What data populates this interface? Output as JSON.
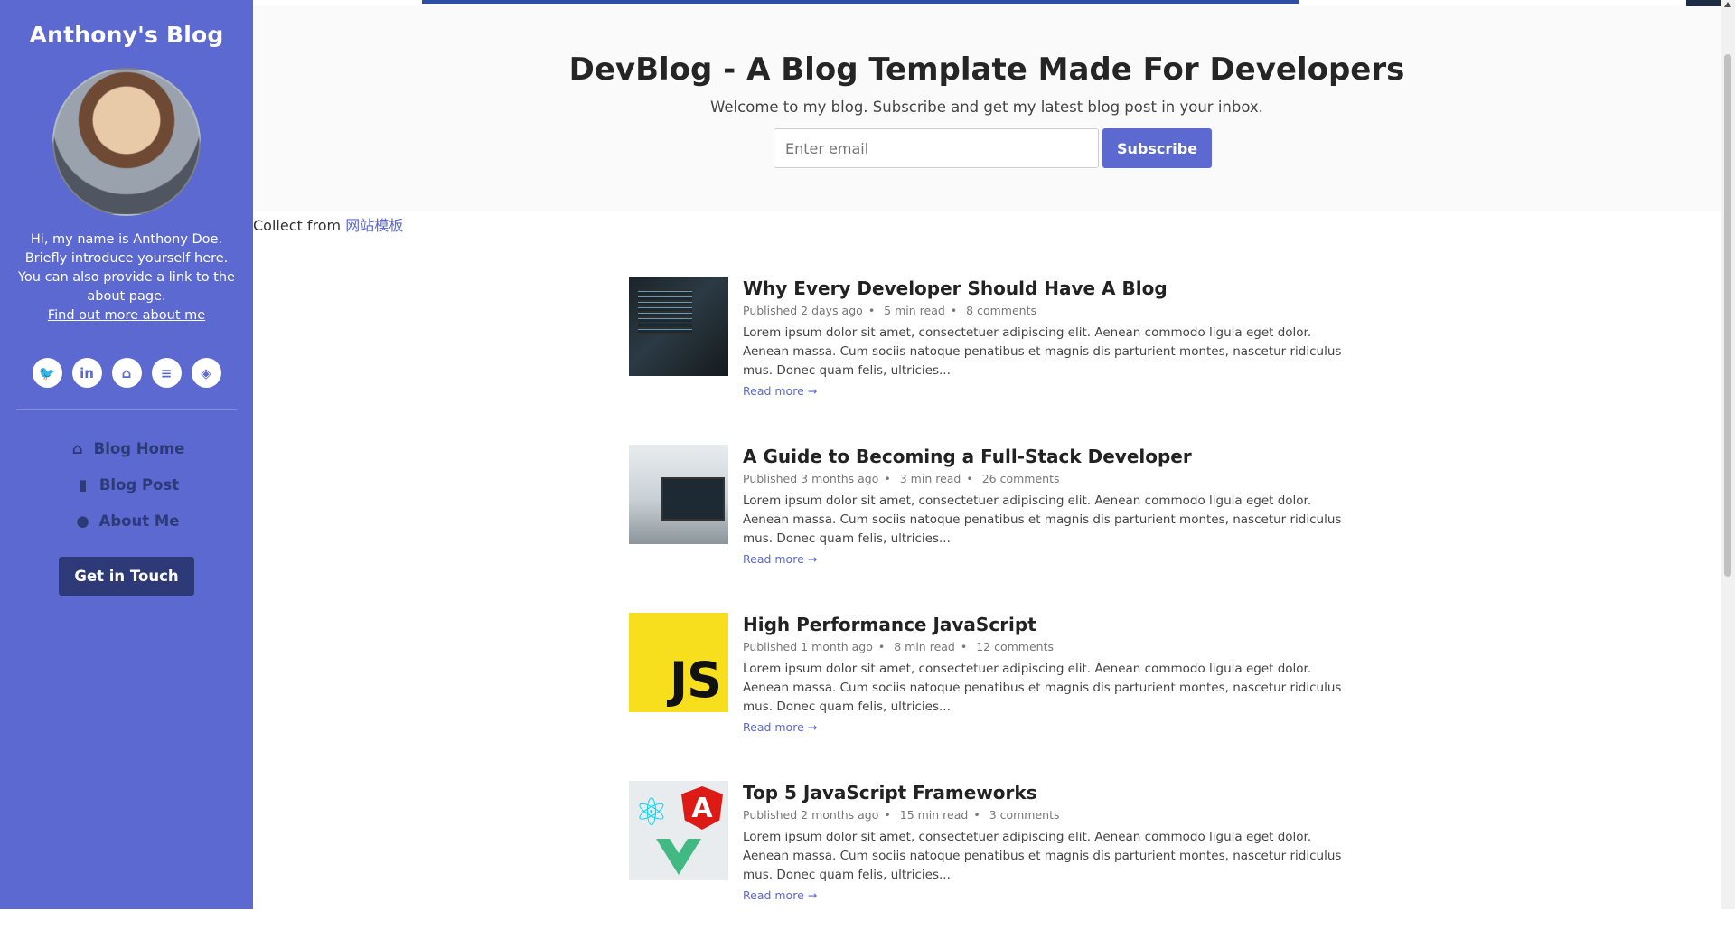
{
  "sidebar": {
    "site_title": "Anthony's Blog",
    "bio": "Hi, my name is Anthony Doe. Briefly introduce yourself here. You can also provide a link to the about page.",
    "about_link": "Find out more about me",
    "socials": [
      {
        "icon": "twitter-icon",
        "glyph": "🐦"
      },
      {
        "icon": "linkedin-icon",
        "glyph": "in"
      },
      {
        "icon": "github-icon",
        "glyph": "⌂"
      },
      {
        "icon": "stackoverflow-icon",
        "glyph": "≡"
      },
      {
        "icon": "codepen-icon",
        "glyph": "◈"
      }
    ],
    "nav": [
      {
        "icon": "home-icon",
        "glyph": "⌂",
        "label": "Blog Home"
      },
      {
        "icon": "bookmark-icon",
        "glyph": "▮",
        "label": "Blog Post"
      },
      {
        "icon": "user-icon",
        "glyph": "●",
        "label": "About Me"
      }
    ],
    "cta": "Get in Touch"
  },
  "hero": {
    "title": "DevBlog - A Blog Template Made For Developers",
    "tagline": "Welcome to my blog. Subscribe and get my latest blog post in your inbox.",
    "email_placeholder": "Enter email",
    "subscribe": "Subscribe"
  },
  "collect": {
    "prefix": "Collect from",
    "link": "网站模板"
  },
  "colors": {
    "sidebar": "#5b69d1",
    "nav_text": "#2e3a78",
    "accent": "#5b69d1",
    "progress": "#2e4fa5"
  },
  "posts": [
    {
      "title": "Why Every Developer Should Have A Blog",
      "published": "Published 2 days ago",
      "read_time": "5 min read",
      "comments": "8 comments",
      "excerpt": "Lorem ipsum dolor sit amet, consectetuer adipiscing elit. Aenean commodo ligula eget dolor. Aenean massa. Cum sociis natoque penatibus et magnis dis parturient montes, nascetur ridiculus mus. Donec quam felis, ultricies...",
      "read_more": "Read more →"
    },
    {
      "title": "A Guide to Becoming a Full-Stack Developer",
      "published": "Published 3 months ago",
      "read_time": "3 min read",
      "comments": "26 comments",
      "excerpt": "Lorem ipsum dolor sit amet, consectetuer adipiscing elit. Aenean commodo ligula eget dolor. Aenean massa. Cum sociis natoque penatibus et magnis dis parturient montes, nascetur ridiculus mus. Donec quam felis, ultricies...",
      "read_more": "Read more →"
    },
    {
      "title": "High Performance JavaScript",
      "published": "Published 1 month ago",
      "read_time": "8 min read",
      "comments": "12 comments",
      "excerpt": "Lorem ipsum dolor sit amet, consectetuer adipiscing elit. Aenean commodo ligula eget dolor. Aenean massa. Cum sociis natoque penatibus et magnis dis parturient montes, nascetur ridiculus mus. Donec quam felis, ultricies...",
      "read_more": "Read more →",
      "thumb_text": "JS"
    },
    {
      "title": "Top 5 JavaScript Frameworks",
      "published": "Published 2 months ago",
      "read_time": "15 min read",
      "comments": "3 comments",
      "excerpt": "Lorem ipsum dolor sit amet, consectetuer adipiscing elit. Aenean commodo ligula eget dolor. Aenean massa. Cum sociis natoque penatibus et magnis dis parturient montes, nascetur ridiculus mus. Donec quam felis, ultricies...",
      "read_more": "Read more →"
    }
  ]
}
